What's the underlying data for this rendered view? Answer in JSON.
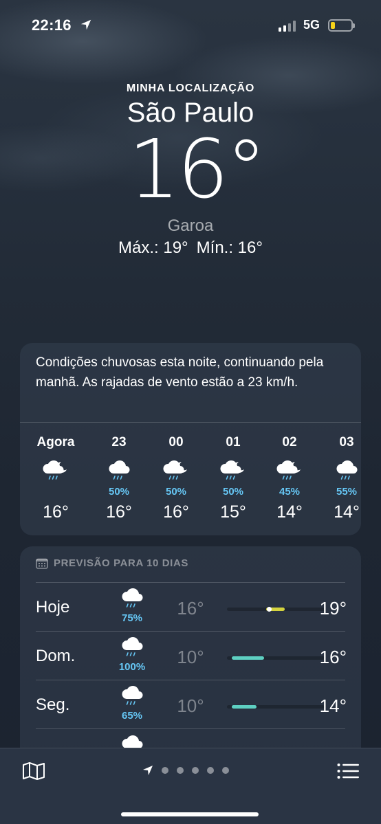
{
  "status": {
    "time": "22:16",
    "network": "5G",
    "battery_level": 0.2,
    "battery_color": "#f7d319"
  },
  "header": {
    "location_label": "MINHA LOCALIZAÇÃO",
    "city": "São Paulo",
    "temperature": "16°",
    "condition": "Garoa",
    "high": "Máx.: 19°",
    "low": "Mín.: 16°"
  },
  "hourly": {
    "summary": "Condições chuvosas esta noite, continuando pela manhã. As rajadas de vento estão a 23 km/h.",
    "items": [
      {
        "label": "Agora",
        "icon": "cloud-moon-rain-icon",
        "precip": "",
        "temp": "16°"
      },
      {
        "label": "23",
        "icon": "cloud-rain-icon",
        "precip": "50%",
        "temp": "16°"
      },
      {
        "label": "00",
        "icon": "cloud-moon-rain-icon",
        "precip": "50%",
        "temp": "16°"
      },
      {
        "label": "01",
        "icon": "cloud-moon-rain-icon",
        "precip": "50%",
        "temp": "15°"
      },
      {
        "label": "02",
        "icon": "cloud-moon-rain-icon",
        "precip": "45%",
        "temp": "14°"
      },
      {
        "label": "03",
        "icon": "cloud-rain-icon",
        "precip": "55%",
        "temp": "14°"
      }
    ]
  },
  "daily": {
    "title": "PREVISÃO PARA 10 DIAS",
    "days": [
      {
        "name": "Hoje",
        "icon": "cloud-rain-icon",
        "precip": "75%",
        "low": "16°",
        "high": "19°",
        "range_start": 0.4,
        "range_end": 0.59,
        "current": 0.43,
        "fill_color": "#d4d33e"
      },
      {
        "name": "Dom.",
        "icon": "cloud-rain-icon",
        "precip": "100%",
        "low": "10°",
        "high": "16°",
        "range_start": 0.05,
        "range_end": 0.38,
        "fill_color": "#5ed0c2"
      },
      {
        "name": "Seg.",
        "icon": "cloud-rain-icon",
        "precip": "65%",
        "low": "10°",
        "high": "14°",
        "range_start": 0.05,
        "range_end": 0.3,
        "fill_color": "#5ed0c2"
      }
    ]
  },
  "bottom": {
    "pages": 5
  }
}
